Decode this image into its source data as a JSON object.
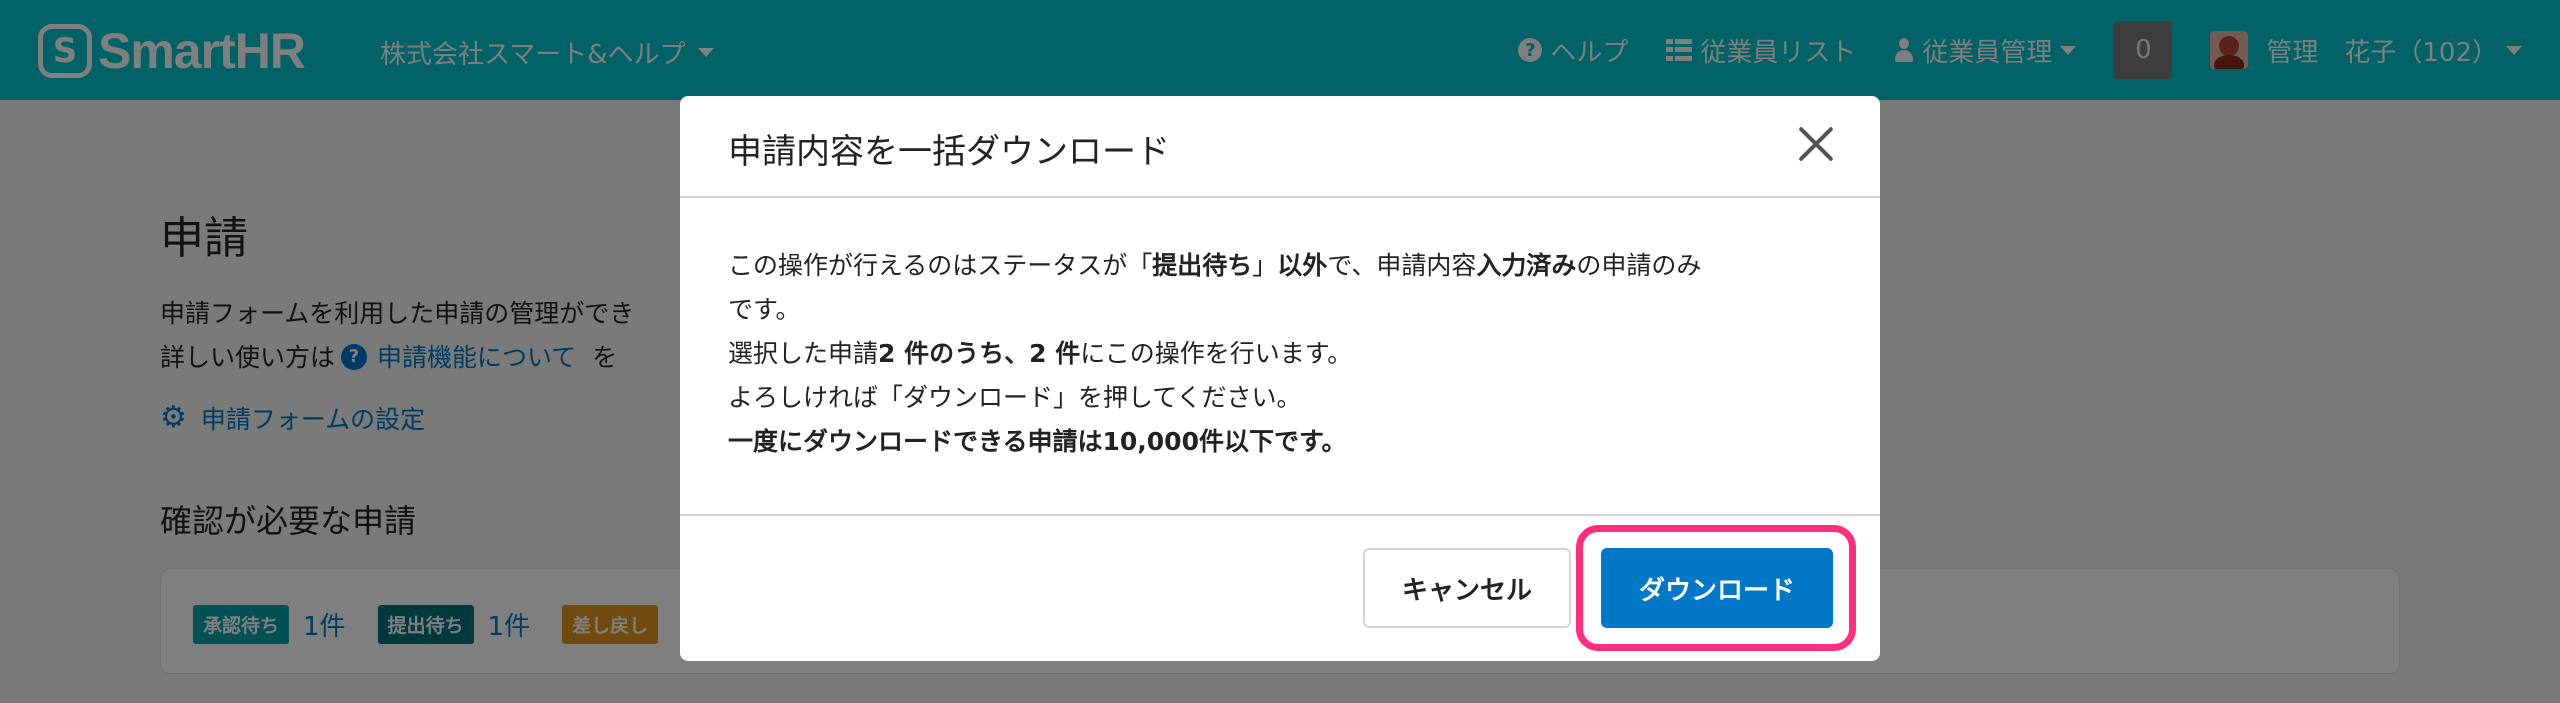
{
  "header": {
    "logo_mark": "S",
    "logo_text": "SmartHR",
    "company": "株式会社スマート&ヘルプ",
    "nav": {
      "help": "ヘルプ",
      "employee_list": "従業員リスト",
      "employee_manage": "従業員管理",
      "notifications": "0",
      "user_name": "管理　花子（102）"
    }
  },
  "page": {
    "title": "申請",
    "desc_line1": "申請フォームを利用した申請の管理ができ",
    "desc_line2_prefix": "詳しい使い方は",
    "desc_link": "申請機能について",
    "desc_line2_suffix": "を",
    "settings_link": "申請フォームの設定",
    "section_title": "確認が必要な申請",
    "badges": [
      {
        "label": "承認待ち",
        "count": "1件",
        "color": "#00a3a8"
      },
      {
        "label": "提出待ち",
        "count": "1件",
        "color": "#007478"
      },
      {
        "label": "差し戻し",
        "count": "",
        "color": "#e0941c"
      }
    ]
  },
  "modal": {
    "title": "申請内容を一括ダウンロード",
    "body": {
      "l1_a": "この操作が行えるのはステータスが「",
      "l1_b": "提出待ち",
      "l1_c": "」",
      "l1_d": "以外",
      "l1_e": "で、申請内容",
      "l1_f": "入力済み",
      "l1_g": "の申請のみ",
      "l2": "です。",
      "l3_a": "選択した申請",
      "l3_b": "2 件のうち、2 件",
      "l3_c": "にこの操作を行います。",
      "l4": "よろしければ「ダウンロード」を押してください。",
      "l5": "一度にダウンロードできる申請は10,000件以下です。"
    },
    "cancel_label": "キャンセル",
    "download_label": "ダウンロード"
  },
  "colors": {
    "header_bg": "#00c4cc",
    "primary": "#0077c7",
    "highlight": "#ff2d7e"
  }
}
